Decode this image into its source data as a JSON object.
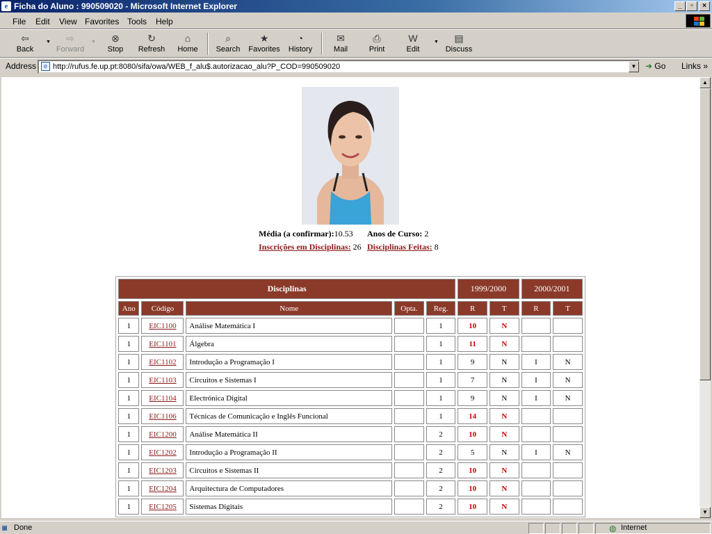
{
  "window": {
    "title": "Ficha do Aluno : 990509020 - Microsoft Internet Explorer"
  },
  "menu": [
    "File",
    "Edit",
    "View",
    "Favorites",
    "Tools",
    "Help"
  ],
  "toolbar": {
    "back": "Back",
    "forward": "Forward",
    "stop": "Stop",
    "refresh": "Refresh",
    "home": "Home",
    "search": "Search",
    "favorites": "Favorites",
    "history": "History",
    "mail": "Mail",
    "print": "Print",
    "edit": "Edit",
    "discuss": "Discuss"
  },
  "address": {
    "label": "Address",
    "url": "http://rufus.fe.up.pt:8080/sifa/owa/WEB_f_alu$.autorizacao_alu?P_COD=990509020",
    "go": "Go",
    "links": "Links"
  },
  "student": {
    "media_label": "Média (a confirmar):",
    "media_value": "10.53",
    "anos_label": "Anos de Curso:",
    "anos_value": "2",
    "inscricoes_label": "Inscrições em Disciplinas:",
    "inscricoes_value": "26",
    "feitas_label": "Disciplinas Feitas:",
    "feitas_value": "8"
  },
  "table": {
    "title": "Disciplinas",
    "year1": "1999/2000",
    "year2": "2000/2001",
    "headers": {
      "ano": "Ano",
      "codigo": "Código",
      "nome": "Nome",
      "opta": "Opta.",
      "reg": "Reg.",
      "r": "R",
      "t": "T"
    },
    "rows": [
      {
        "ano": "1",
        "codigo": "EIC1100",
        "nome": "Análise Matemática I",
        "opta": "",
        "reg": "1",
        "r1": "10",
        "t1": "N",
        "r2": "",
        "t2": "",
        "passed": true
      },
      {
        "ano": "1",
        "codigo": "EIC1101",
        "nome": "Álgebra",
        "opta": "",
        "reg": "1",
        "r1": "11",
        "t1": "N",
        "r2": "",
        "t2": "",
        "passed": true
      },
      {
        "ano": "1",
        "codigo": "EIC1102",
        "nome": "Introdução a Programação I",
        "opta": "",
        "reg": "1",
        "r1": "9",
        "t1": "N",
        "r2": "I",
        "t2": "N",
        "passed": false
      },
      {
        "ano": "1",
        "codigo": "EIC1103",
        "nome": "Circuitos e Sistemas I",
        "opta": "",
        "reg": "1",
        "r1": "7",
        "t1": "N",
        "r2": "I",
        "t2": "N",
        "passed": false
      },
      {
        "ano": "1",
        "codigo": "EIC1104",
        "nome": "Electrónica Digital",
        "opta": "",
        "reg": "1",
        "r1": "9",
        "t1": "N",
        "r2": "I",
        "t2": "N",
        "passed": false
      },
      {
        "ano": "1",
        "codigo": "EIC1106",
        "nome": "Técnicas de Comunicação e Inglês Funcional",
        "opta": "",
        "reg": "1",
        "r1": "14",
        "t1": "N",
        "r2": "",
        "t2": "",
        "passed": true
      },
      {
        "ano": "1",
        "codigo": "EIC1200",
        "nome": "Análise Matemática II",
        "opta": "",
        "reg": "2",
        "r1": "10",
        "t1": "N",
        "r2": "",
        "t2": "",
        "passed": true
      },
      {
        "ano": "1",
        "codigo": "EIC1202",
        "nome": "Introdução a Programação II",
        "opta": "",
        "reg": "2",
        "r1": "5",
        "t1": "N",
        "r2": "I",
        "t2": "N",
        "passed": false
      },
      {
        "ano": "1",
        "codigo": "EIC1203",
        "nome": "Circuitos e Sistemas II",
        "opta": "",
        "reg": "2",
        "r1": "10",
        "t1": "N",
        "r2": "",
        "t2": "",
        "passed": true
      },
      {
        "ano": "1",
        "codigo": "EIC1204",
        "nome": "Arquitectura de Computadores",
        "opta": "",
        "reg": "2",
        "r1": "10",
        "t1": "N",
        "r2": "",
        "t2": "",
        "passed": true
      },
      {
        "ano": "1",
        "codigo": "EIC1205",
        "nome": "Sistemas Digitais",
        "opta": "",
        "reg": "2",
        "r1": "10",
        "t1": "N",
        "r2": "",
        "t2": "",
        "passed": true
      }
    ]
  },
  "status": {
    "text": "Done",
    "zone": "Internet"
  },
  "colors": {
    "header_bg": "#8b3a2a",
    "link": "#8b1a1a",
    "grade_red": "#d00000"
  }
}
